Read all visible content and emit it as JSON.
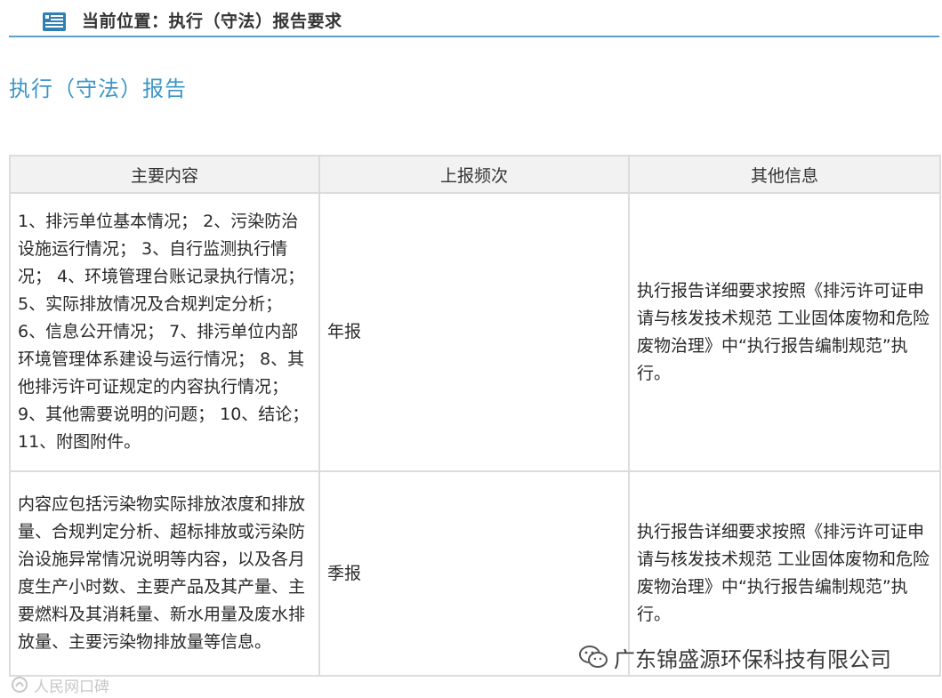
{
  "breadcrumb": {
    "icon": "document-list-icon",
    "text": "当前位置：执行（守法）报告要求"
  },
  "page_title": "执行（守法）报告",
  "table": {
    "headers": [
      "主要内容",
      "上报频次",
      "其他信息"
    ],
    "rows": [
      {
        "content": "1、排污单位基本情况； 2、污染防治设施运行情况； 3、自行监测执行情况； 4、环境管理台账记录执行情况； 5、实际排放情况及合规判定分析； 6、信息公开情况； 7、排污单位内部环境管理体系建设与运行情况； 8、其他排污许可证规定的内容执行情况； 9、其他需要说明的问题； 10、结论； 11、附图附件。",
        "frequency": "年报",
        "other": "执行报告详细要求按照《排污许可证申请与核发技术规范 工业固体废物和危险废物治理》中“执行报告编制规范”执行。"
      },
      {
        "content": "内容应包括污染物实际排放浓度和排放量、合规判定分析、超标排放或污染防治设施异常情况说明等内容，以及各月度生产小时数、主要产品及其产量、主要燃料及其消耗量、新水用量及废水排放量、主要污染物排放量等信息。",
        "frequency": "季报",
        "other": "执行报告详细要求按照《排污许可证申请与核发技术规范 工业固体废物和危险废物治理》中“执行报告编制规范”执行。"
      }
    ]
  },
  "watermarks": {
    "right_text": "广东锦盛源环保科技有限公司",
    "right_icon": "wechat-icon",
    "left_text": "人民网口碑",
    "left_icon": "brand-icon"
  },
  "colors": {
    "accent": "#3d95c8",
    "divider": "#5aa0c8",
    "header_bg": "#f2f2f2",
    "border": "#dcdcdc"
  }
}
